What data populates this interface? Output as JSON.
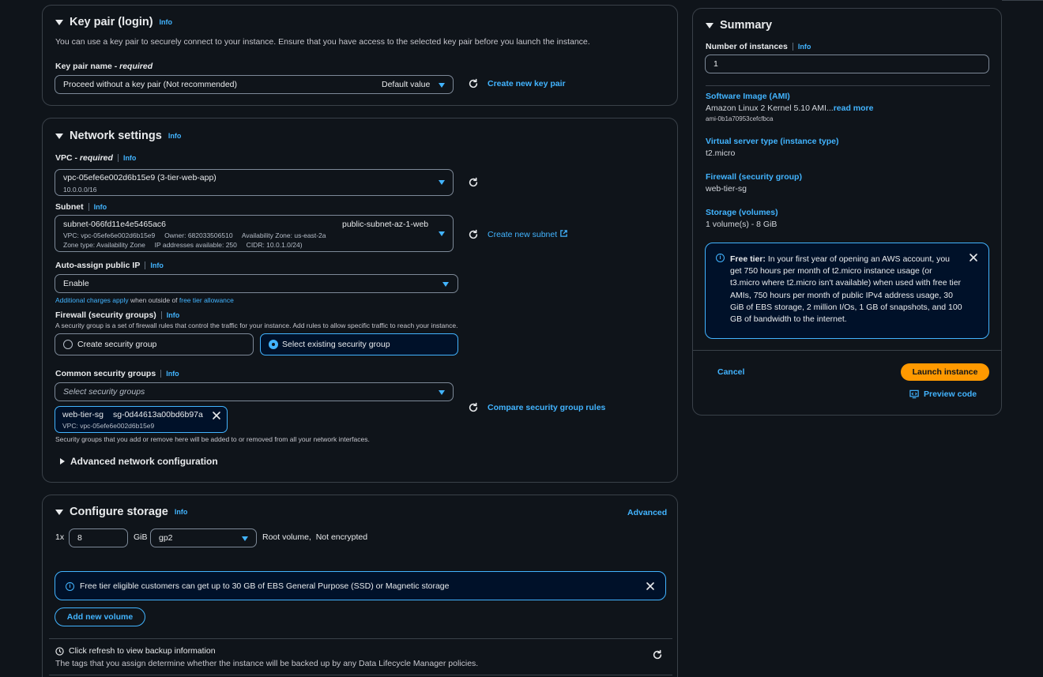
{
  "keypair": {
    "title": "Key pair (login)",
    "info": "Info",
    "description": "You can use a key pair to securely connect to your instance. Ensure that you have access to the selected key pair before you launch the instance.",
    "name_label": "Key pair name - ",
    "name_required": "required",
    "selected": "Proceed without a key pair (Not recommended)",
    "default_tag": "Default value",
    "create_link": "Create new key pair"
  },
  "network": {
    "title": "Network settings",
    "info": "Info",
    "vpc_label": "VPC - ",
    "vpc_required": "required",
    "vpc_value": "vpc-05efe6e002d6b15e9 (3-tier-web-app)",
    "vpc_cidr": "10.0.0.0/16",
    "subnet_label": "Subnet",
    "subnet_id": "subnet-066fd11e4e5465ac6",
    "subnet_name": "public-subnet-az-1-web",
    "subnet_line2": "VPC: vpc-05efe6e002d6b15e9     Owner: 682033506510     Availability Zone: us-east-2a",
    "subnet_line3": "Zone type: Availability Zone     IP addresses available: 250     CIDR: 10.0.1.0/24)",
    "create_subnet": "Create new subnet",
    "autoassign_label": "Auto-assign public IP",
    "autoassign_value": "Enable",
    "charges_link": "Additional charges apply",
    "charges_mid": " when outside of ",
    "charges_link2": "free tier allowance",
    "firewall_label": "Firewall (security groups)",
    "firewall_desc": "A security group is a set of firewall rules that control the traffic for your instance. Add rules to allow specific traffic to reach your instance.",
    "create_sg": "Create security group",
    "select_sg": "Select existing security group",
    "common_label": "Common security groups",
    "common_placeholder": "Select security groups",
    "token_name": "web-tier-sg",
    "token_id": "sg-0d44613a00bd6b97a",
    "token_vpc": "VPC: vpc-05efe6e002d6b15e9",
    "compare_link": "Compare security group rules",
    "sg_note": "Security groups that you add or remove here will be added to or removed from all your network interfaces.",
    "advanced": "Advanced network configuration"
  },
  "storage": {
    "title": "Configure storage",
    "info": "Info",
    "advanced_link": "Advanced",
    "count": "1x",
    "size": "8",
    "unit": "GiB",
    "type": "gp2",
    "root_text": "Root volume,  Not encrypted",
    "alert": "Free tier eligible customers can get up to 30 GB of EBS General Purpose (SSD) or Magnetic storage",
    "add_volume": "Add new volume",
    "backup_title": "Click refresh to view backup information",
    "backup_desc": "The tags that you assign determine whether the instance will be backed up by any Data Lifecycle Manager policies."
  },
  "summary": {
    "title": "Summary",
    "instances_label": "Number of instances",
    "info": "Info",
    "instances_value": "1",
    "ami_label": "Software Image (AMI)",
    "ami_value": "Amazon Linux 2 Kernel 5.10 AMI...",
    "ami_more": "read more",
    "ami_id": "ami-0b1a70953cefcfbca",
    "type_label": "Virtual server type (instance type)",
    "type_value": "t2.micro",
    "fw_label": "Firewall (security group)",
    "fw_value": "web-tier-sg",
    "storage_label": "Storage (volumes)",
    "storage_value": "1 volume(s) - 8 GiB",
    "freetier_bold": "Free tier:",
    "freetier_text": " In your first year of opening an AWS account, you get 750 hours per month of t2.micro instance usage (or t3.micro where t2.micro isn't available) when used with free tier AMIs, 750 hours per month of public IPv4 address usage, 30 GiB of EBS storage, 2 million I/Os, 1 GB of snapshots, and 100 GB of bandwidth to the internet.",
    "cancel": "Cancel",
    "launch": "Launch instance",
    "preview": "Preview code"
  },
  "colors": {
    "accent": "#42b4ff",
    "launch": "#ff9900",
    "bg": "#0f141a"
  }
}
